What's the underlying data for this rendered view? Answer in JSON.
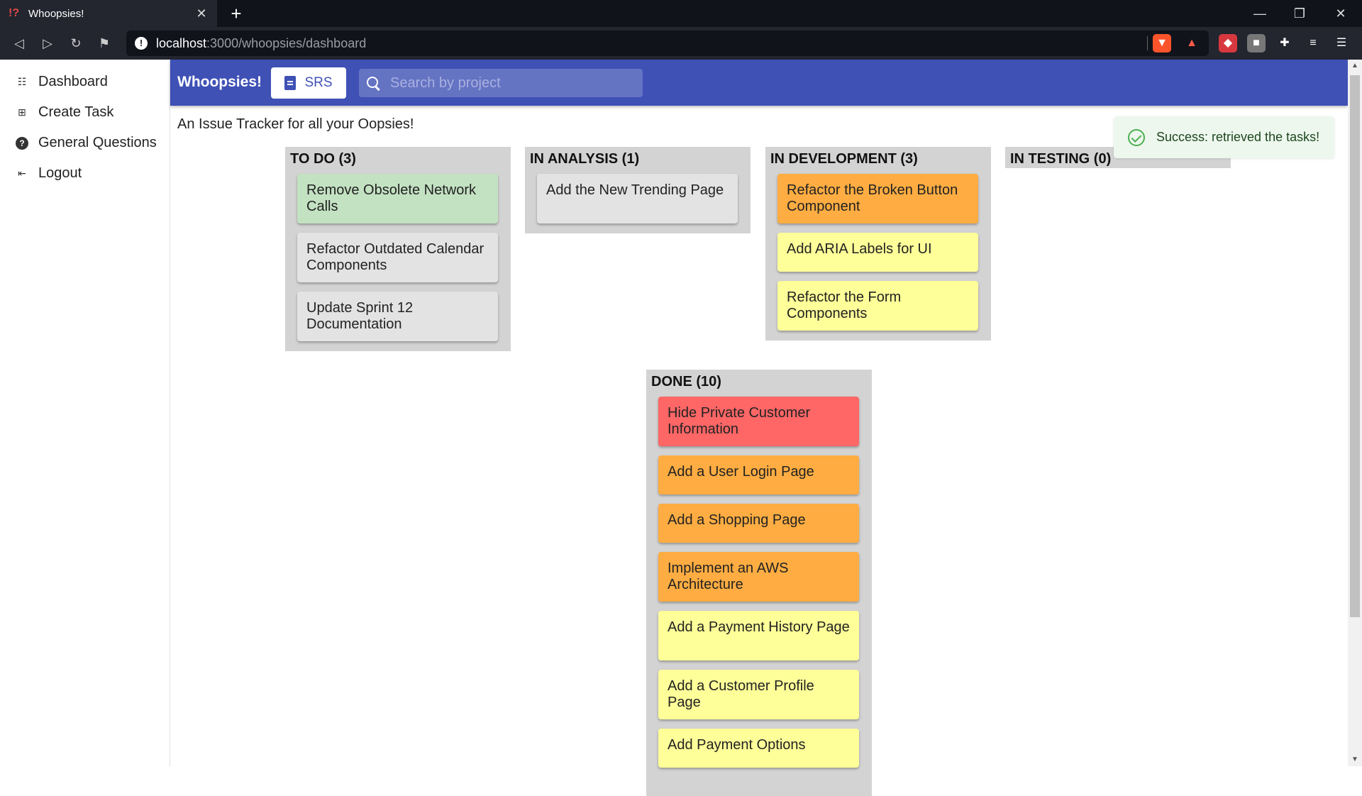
{
  "browser": {
    "tab_title": "Whoopsies!",
    "tab_favicon": "!?",
    "url_host": "localhost",
    "url_path": ":3000/whoopsies/dashboard"
  },
  "sidebar": {
    "items": [
      {
        "label": "Dashboard",
        "icon": "list-icon"
      },
      {
        "label": "Create Task",
        "icon": "add-box-icon"
      },
      {
        "label": "General Questions",
        "icon": "help-icon"
      },
      {
        "label": "Logout",
        "icon": "logout-icon"
      }
    ]
  },
  "appbar": {
    "brand": "Whoopsies!",
    "srs_label": "SRS",
    "search_placeholder": "Search by project",
    "color": "#3f51b5"
  },
  "tagline": "An Issue Tracker for all your Oopsies!",
  "toast": {
    "message": "Success: retrieved the tasks!"
  },
  "colors": {
    "green": "#c3e2c2",
    "grey": "#e3e3e3",
    "orange": "#ffad42",
    "yellow": "#ffff99",
    "red": "#ff6666"
  },
  "columns": [
    {
      "title": "TO DO (3)",
      "cards": [
        {
          "text": "Remove Obsolete Network Calls",
          "color": "green"
        },
        {
          "text": "Refactor Outdated Calendar Components",
          "color": "grey"
        },
        {
          "text": "Update Sprint 12 Documentation",
          "color": "grey"
        }
      ]
    },
    {
      "title": "IN ANALYSIS (1)",
      "cards": [
        {
          "text": "Add the New Trending Page",
          "color": "grey"
        }
      ]
    },
    {
      "title": "IN DEVELOPMENT (3)",
      "cards": [
        {
          "text": "Refactor the Broken Button Component",
          "color": "orange"
        },
        {
          "text": "Add ARIA Labels for UI",
          "color": "yellow"
        },
        {
          "text": "Refactor the Form Components",
          "color": "yellow"
        }
      ]
    },
    {
      "title": "IN TESTING (0)",
      "cards": []
    },
    {
      "title": "DONE (10)",
      "cards": [
        {
          "text": "Hide Private Customer Information",
          "color": "red"
        },
        {
          "text": "Add a User Login Page",
          "color": "orange"
        },
        {
          "text": "Add a Shopping Page",
          "color": "orange"
        },
        {
          "text": "Implement an AWS Architecture",
          "color": "orange"
        },
        {
          "text": "Add a Payment History Page",
          "color": "yellow"
        },
        {
          "text": "Add a Customer Profile Page",
          "color": "yellow"
        },
        {
          "text": "Add Payment Options",
          "color": "yellow"
        }
      ]
    }
  ]
}
